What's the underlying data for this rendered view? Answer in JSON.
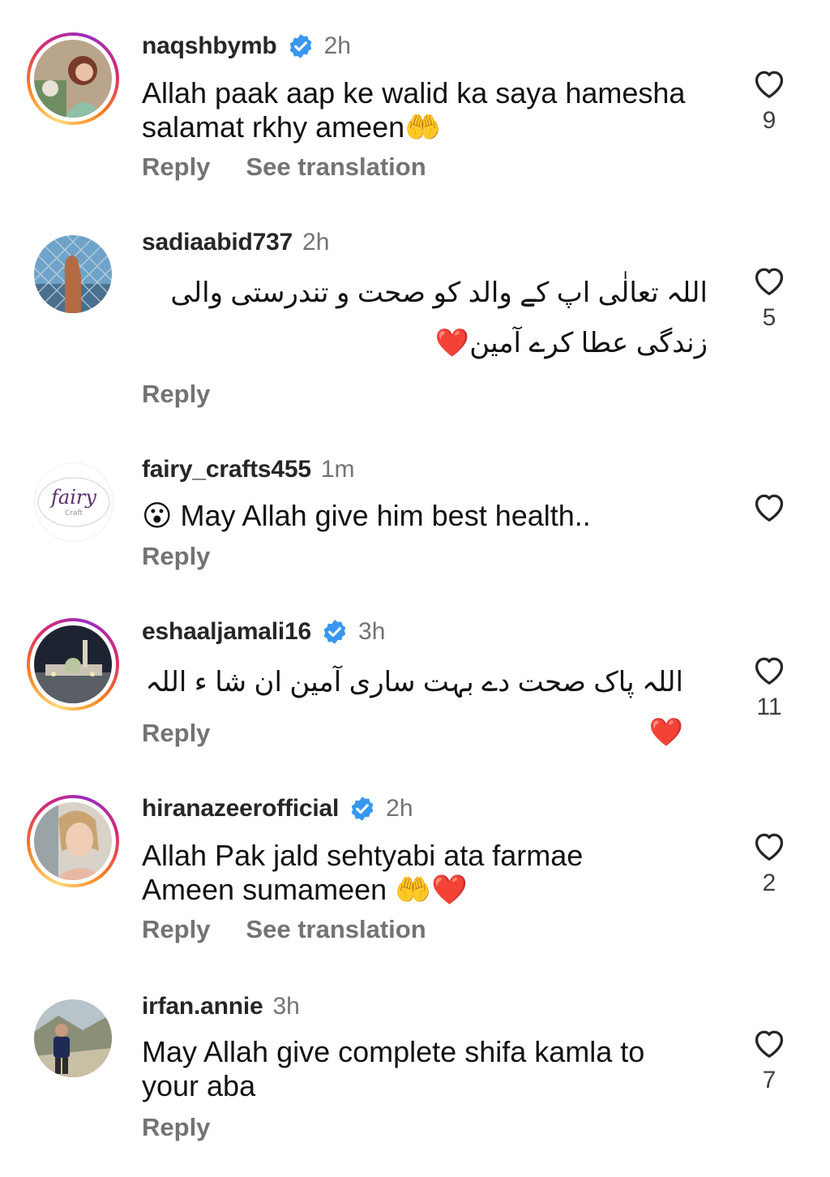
{
  "comments": [
    {
      "username": "naqshbymb",
      "verified": true,
      "time": "2h",
      "text_lines": [
        "Allah paak aap ke walid ka saya hamesha",
        "salamat rkhy ameen🤲"
      ],
      "reply": "Reply",
      "translate": "See translation",
      "likes": "9",
      "story_ring": true
    },
    {
      "username": "sadiaabid737",
      "verified": false,
      "time": "2h",
      "text_lines": [
        "اللہ تعالٰی اپ کے والد کو صحت و تندرستی  والی",
        "زندگی عطا کرے آمین❤️"
      ],
      "reply": "Reply",
      "likes": "5",
      "story_ring": false
    },
    {
      "username": "fairy_crafts455",
      "verified": false,
      "time": "1m",
      "text_lines": [
        "😮 May Allah give him best health.."
      ],
      "reply": "Reply",
      "likes": "",
      "story_ring": false,
      "avatar_text": "fairy",
      "avatar_subtext": "Craft"
    },
    {
      "username": "eshaaljamali16",
      "verified": true,
      "time": "3h",
      "text_lines": [
        "اللہ پاک صحت دے بہت ساری آمین ان شا ء اللہ❤️"
      ],
      "reply": "Reply",
      "likes": "11",
      "story_ring": true
    },
    {
      "username": "hiranazeerofficial",
      "verified": true,
      "time": "2h",
      "text_lines": [
        "Allah Pak jald sehtyabi ata farmae",
        "Ameen sumameen 🤲❤️"
      ],
      "reply": "Reply",
      "translate": "See translation",
      "likes": "2",
      "story_ring": true
    },
    {
      "username": "irfan.annie",
      "verified": false,
      "time": "3h",
      "text_lines": [
        "May Allah give complete shifa kamla to",
        "your aba"
      ],
      "reply": "Reply",
      "likes": "7",
      "story_ring": false
    }
  ],
  "colors": {
    "verified_badge": "#3897f0",
    "secondary_text": "#737373",
    "primary_text": "#111111"
  },
  "icons": {
    "like": "heart-outline-icon",
    "verified": "verified-badge-icon"
  }
}
